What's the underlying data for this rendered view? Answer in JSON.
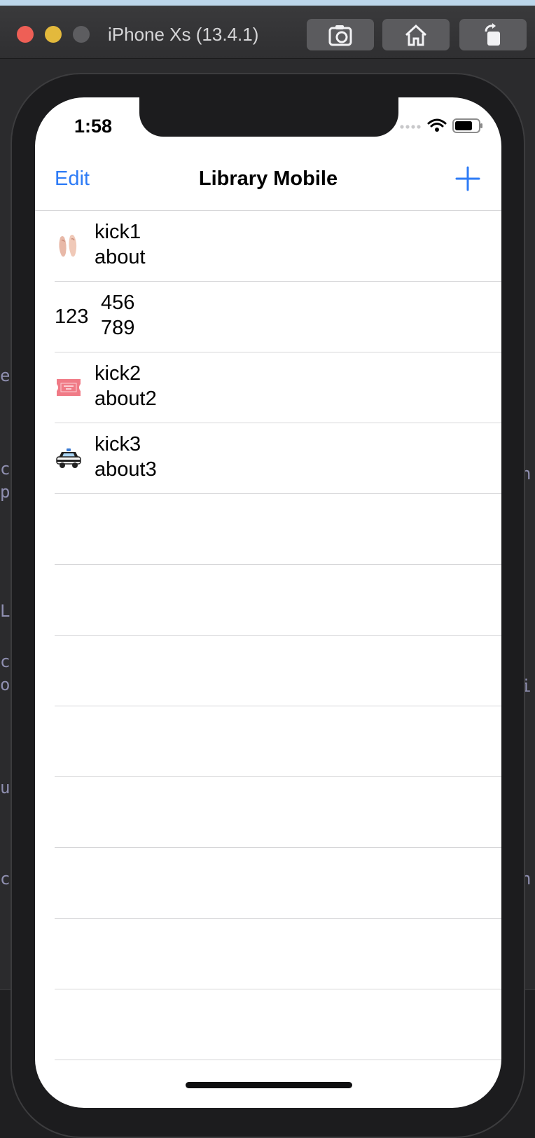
{
  "window": {
    "title": "iPhone Xs (13.4.1)",
    "buttons": [
      "screenshot-icon",
      "home-icon",
      "rotate-icon"
    ]
  },
  "status_bar": {
    "time": "1:58"
  },
  "nav": {
    "edit_label": "Edit",
    "title": "Library Mobile",
    "add_icon": "plus-icon"
  },
  "rows": [
    {
      "icon": "ballet-shoes-emoji",
      "title": "kick1",
      "subtitle": "about"
    },
    {
      "lead": "123",
      "title": "456",
      "subtitle": "789"
    },
    {
      "icon": "admission-ticket-emoji",
      "title": "kick2",
      "subtitle": "about2"
    },
    {
      "icon": "police-car-emoji",
      "title": "kick3",
      "subtitle": "about3"
    }
  ],
  "colors": {
    "accent": "#2d7bf6",
    "separator": "#d6d6d8"
  }
}
